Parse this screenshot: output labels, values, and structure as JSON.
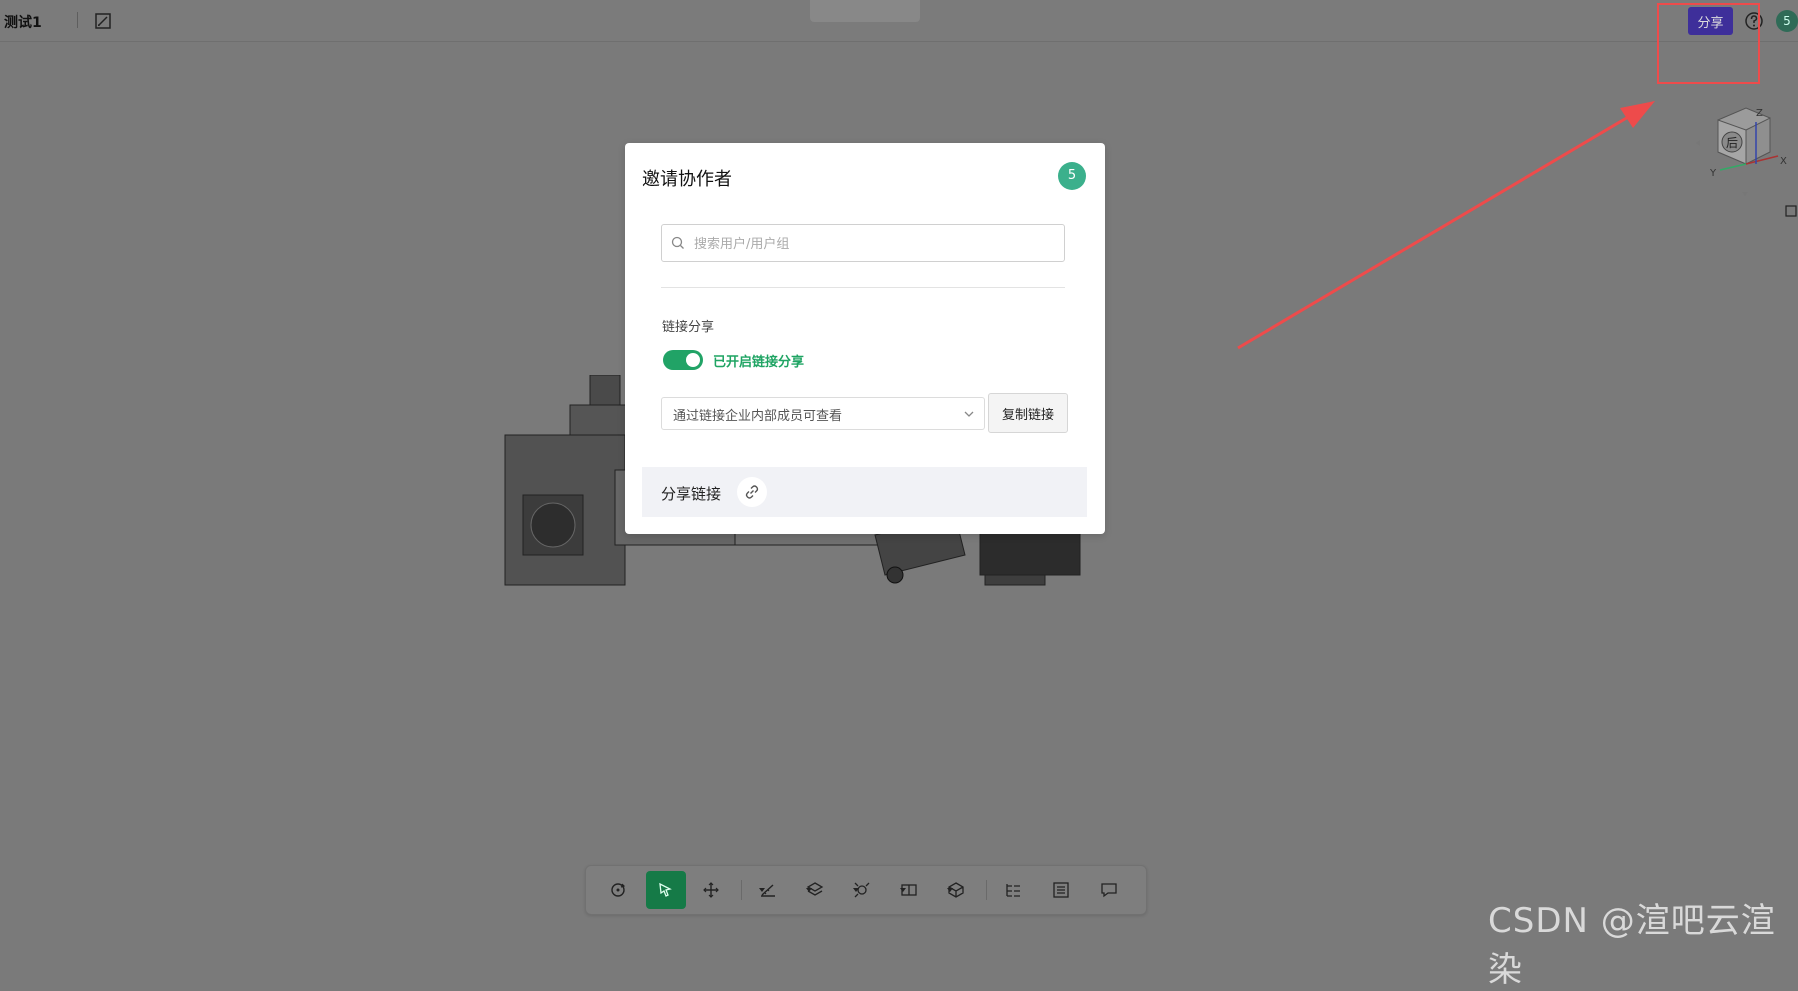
{
  "header": {
    "doc_title": "测试1",
    "share_label": "分享",
    "user_count": "5",
    "icons": [
      "edit-icon",
      "help-icon"
    ]
  },
  "dialog": {
    "title": "邀请协作者",
    "count": "5",
    "search_placeholder": "搜索用户/用户组",
    "section_label": "链接分享",
    "toggle_on": true,
    "toggle_label": "已开启链接分享",
    "permission_select": "通过链接企业内部成员可查看",
    "copy_label": "复制链接",
    "share_link_label": "分享链接"
  },
  "view_cube": {
    "face": "后",
    "axes": [
      "Z",
      "X",
      "Y"
    ]
  },
  "toolbar": {
    "tools": [
      "rotate-icon",
      "select-icon",
      "move-icon",
      "measure-icon",
      "section-icon",
      "explode-icon",
      "view-icon",
      "display-icon",
      "tree-icon",
      "list-icon",
      "comment-icon"
    ],
    "active": "select-icon"
  },
  "watermark": "CSDN @渲吧云渲染",
  "colors": {
    "accent": "#3e2f9a",
    "toggle": "#21a366",
    "badge": "#3bb08c",
    "annotation": "#ee4b4b"
  }
}
